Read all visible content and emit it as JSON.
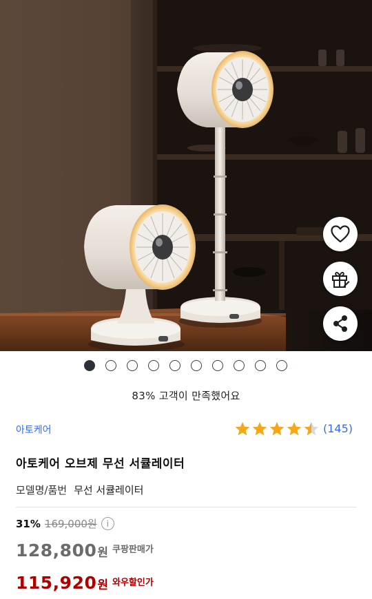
{
  "gallery": {
    "image_count": 10,
    "active_index": 0
  },
  "satisfaction": "83% 고객이 만족했어요",
  "product": {
    "brand": "아토케어",
    "rating": 4.5,
    "review_count": "(145)",
    "title": "아토케어 오브제 무선 서큘레이터",
    "model_label": "모델명/품번",
    "model_value": "무선 서큘레이터"
  },
  "price": {
    "discount_rate": "31%",
    "original_price": "169,000원",
    "sale_price": "128,800",
    "sale_unit": "원",
    "sale_label": "쿠팡판매가",
    "member_price": "115,920",
    "member_unit": "원",
    "member_label": "와우할인가"
  },
  "icons": {
    "info": "i",
    "wishlist": "heart-icon",
    "gift": "gift-icon",
    "share": "share-icon",
    "star": "star-icon"
  },
  "colors": {
    "brand_link": "#346aff",
    "star": "#f6a716",
    "member_price": "#ae0000",
    "sale_price": "#6b6b6b"
  }
}
